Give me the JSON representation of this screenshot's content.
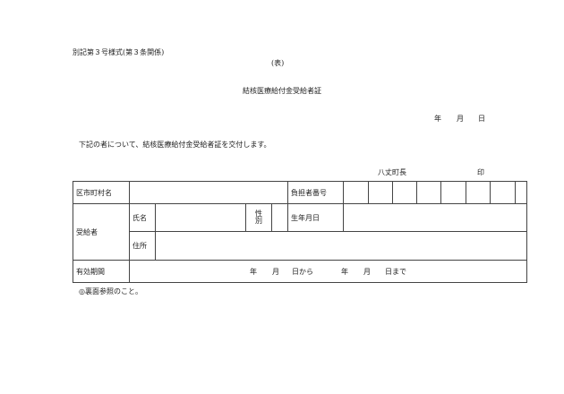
{
  "header": {
    "form_label": "別記第３号様式(第３条関係)",
    "side_label": "(表)",
    "title": "結核医療給付金受給者証"
  },
  "date_line": {
    "year": "年",
    "month": "月",
    "day": "日"
  },
  "intro_text": "下記の者について、結核医療給付金受給者証を交付します。",
  "issuer": {
    "name": "八丈町長",
    "seal": "印"
  },
  "table": {
    "municipality_label": "区市町村名",
    "burden_number_label": "負担者番号",
    "recipient_label": "受給者",
    "name_label": "氏名",
    "sex_label_top": "性",
    "sex_label_bottom": "別",
    "birthdate_label": "生年月日",
    "address_label": "住所",
    "validity_label": "有効期間",
    "validity": {
      "year1": "年",
      "month1": "月",
      "from": "日から",
      "year2": "年",
      "month2": "月",
      "until": "日まで"
    }
  },
  "note": "◎裏面参照のこと。"
}
